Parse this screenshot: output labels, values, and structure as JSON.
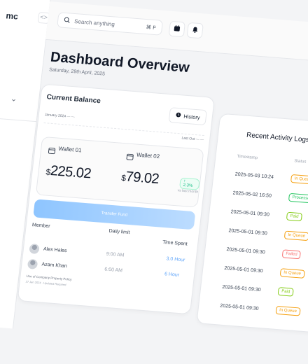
{
  "sidebar": {
    "brand": "mc",
    "collapse_label": "<>",
    "chevron": "⌄"
  },
  "topbar": {
    "search_placeholder": "Search anything",
    "search_shortcut": "⌘ F",
    "calendar_icon": "calendar-icon",
    "bell_icon": "bell-icon"
  },
  "page": {
    "title": "Dashboard Overview",
    "date": "Saturday, 29th April, 2025"
  },
  "balance": {
    "title": "Current Balance",
    "history_label": "History",
    "period": "January 2024   — —",
    "last_out": "Last Out   — —",
    "wallets": [
      {
        "name": "Wallet 01",
        "currency": "$",
        "amount": "225.02"
      },
      {
        "name": "Wallet 02",
        "currency": "$",
        "amount": "79.02",
        "trend": "↑ 2.3%",
        "trend_note": "vs last month"
      }
    ],
    "transfer_label": "Transfer Fund",
    "table": {
      "headers": [
        "Member",
        "Daily limit",
        "Time Spent"
      ],
      "rows": [
        {
          "name": "Alex Hales",
          "limit": "9:00 AM",
          "time": "3.0 Hour"
        },
        {
          "name": "Azam Khan",
          "limit": "6:00 AM",
          "time": "6 Hour"
        }
      ]
    },
    "policy": "Use of Company Property Policy",
    "policy_meta": "27 Jan 2024   ·   Updated Required"
  },
  "activity": {
    "title": "Recent Activity Logs",
    "headers": [
      "Timestamp",
      "Status"
    ],
    "rows": [
      {
        "time": "2025-05-03 10:24",
        "status": "In Queue",
        "tone": "queue"
      },
      {
        "time": "2025-05-02 16:50",
        "status": "Processed",
        "tone": "processed"
      },
      {
        "time": "2025-05-01 09:30",
        "status": "Paid",
        "tone": "paid"
      },
      {
        "time": "2025-05-01 09:30",
        "status": "In Queue",
        "tone": "queue"
      },
      {
        "time": "2025-05-01 09:30",
        "status": "Failed",
        "tone": "failed"
      },
      {
        "time": "2025-05-01 09:30",
        "status": "In Queue",
        "tone": "queue"
      },
      {
        "time": "2025-05-01 09:30",
        "status": "Paid",
        "tone": "paid"
      },
      {
        "time": "2025-05-01 09:30",
        "status": "In Queue",
        "tone": "queue"
      }
    ],
    "colors": {
      "queue": "#f59e0b",
      "processed": "#22c55e",
      "paid": "#84cc16",
      "failed": "#f87171"
    }
  }
}
